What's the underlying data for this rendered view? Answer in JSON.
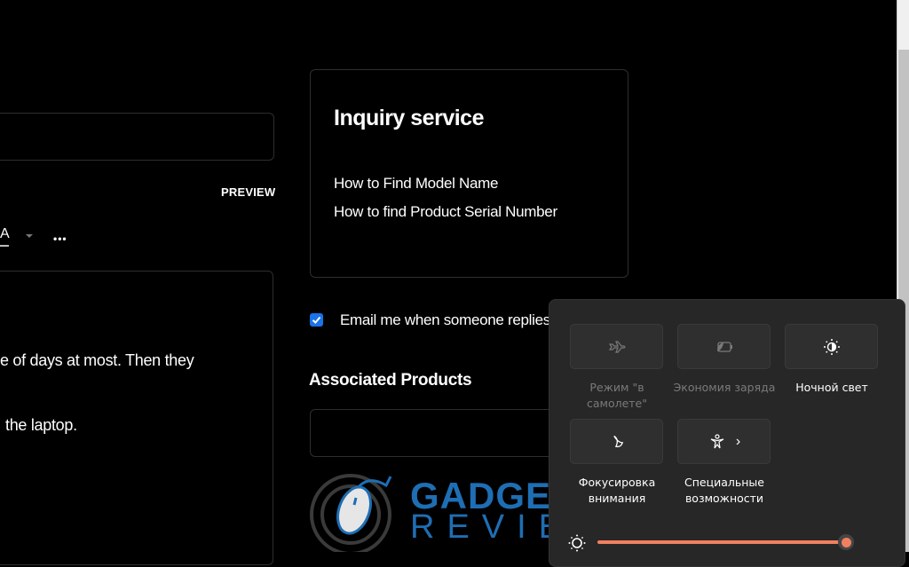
{
  "editor": {
    "preview_label": "PREVIEW",
    "format_font_label": "A",
    "more_label": "•••",
    "body_lines": [
      "e of days at most. Then they",
      "the laptop."
    ]
  },
  "inquiry": {
    "title": "Inquiry service",
    "links": [
      "How to Find Model Name",
      "How to find Product Serial Number"
    ]
  },
  "email_notify": {
    "label": "Email me when someone replies",
    "checked": true
  },
  "associated_products": {
    "title": "Associated Products"
  },
  "watermark": {
    "line1": "GADGETS",
    "line2": "REVIEW"
  },
  "quick_settings": {
    "tiles": [
      {
        "name": "airplane",
        "label": "Режим \"в самолете\"",
        "enabled": false,
        "icon": "airplane-icon"
      },
      {
        "name": "battery-saver",
        "label": "Экономия заряда",
        "enabled": false,
        "icon": "battery-saver-icon"
      },
      {
        "name": "night-light",
        "label": "Ночной свет",
        "enabled": true,
        "icon": "night-light-icon"
      },
      {
        "name": "focus",
        "label": "Фокусировка внимания",
        "enabled": true,
        "icon": "moon-icon"
      },
      {
        "name": "accessibility",
        "label": "Специальные возможности",
        "enabled": true,
        "icon": "accessibility-icon"
      }
    ],
    "brightness_percent": 100,
    "accent_color": "#f08060"
  }
}
